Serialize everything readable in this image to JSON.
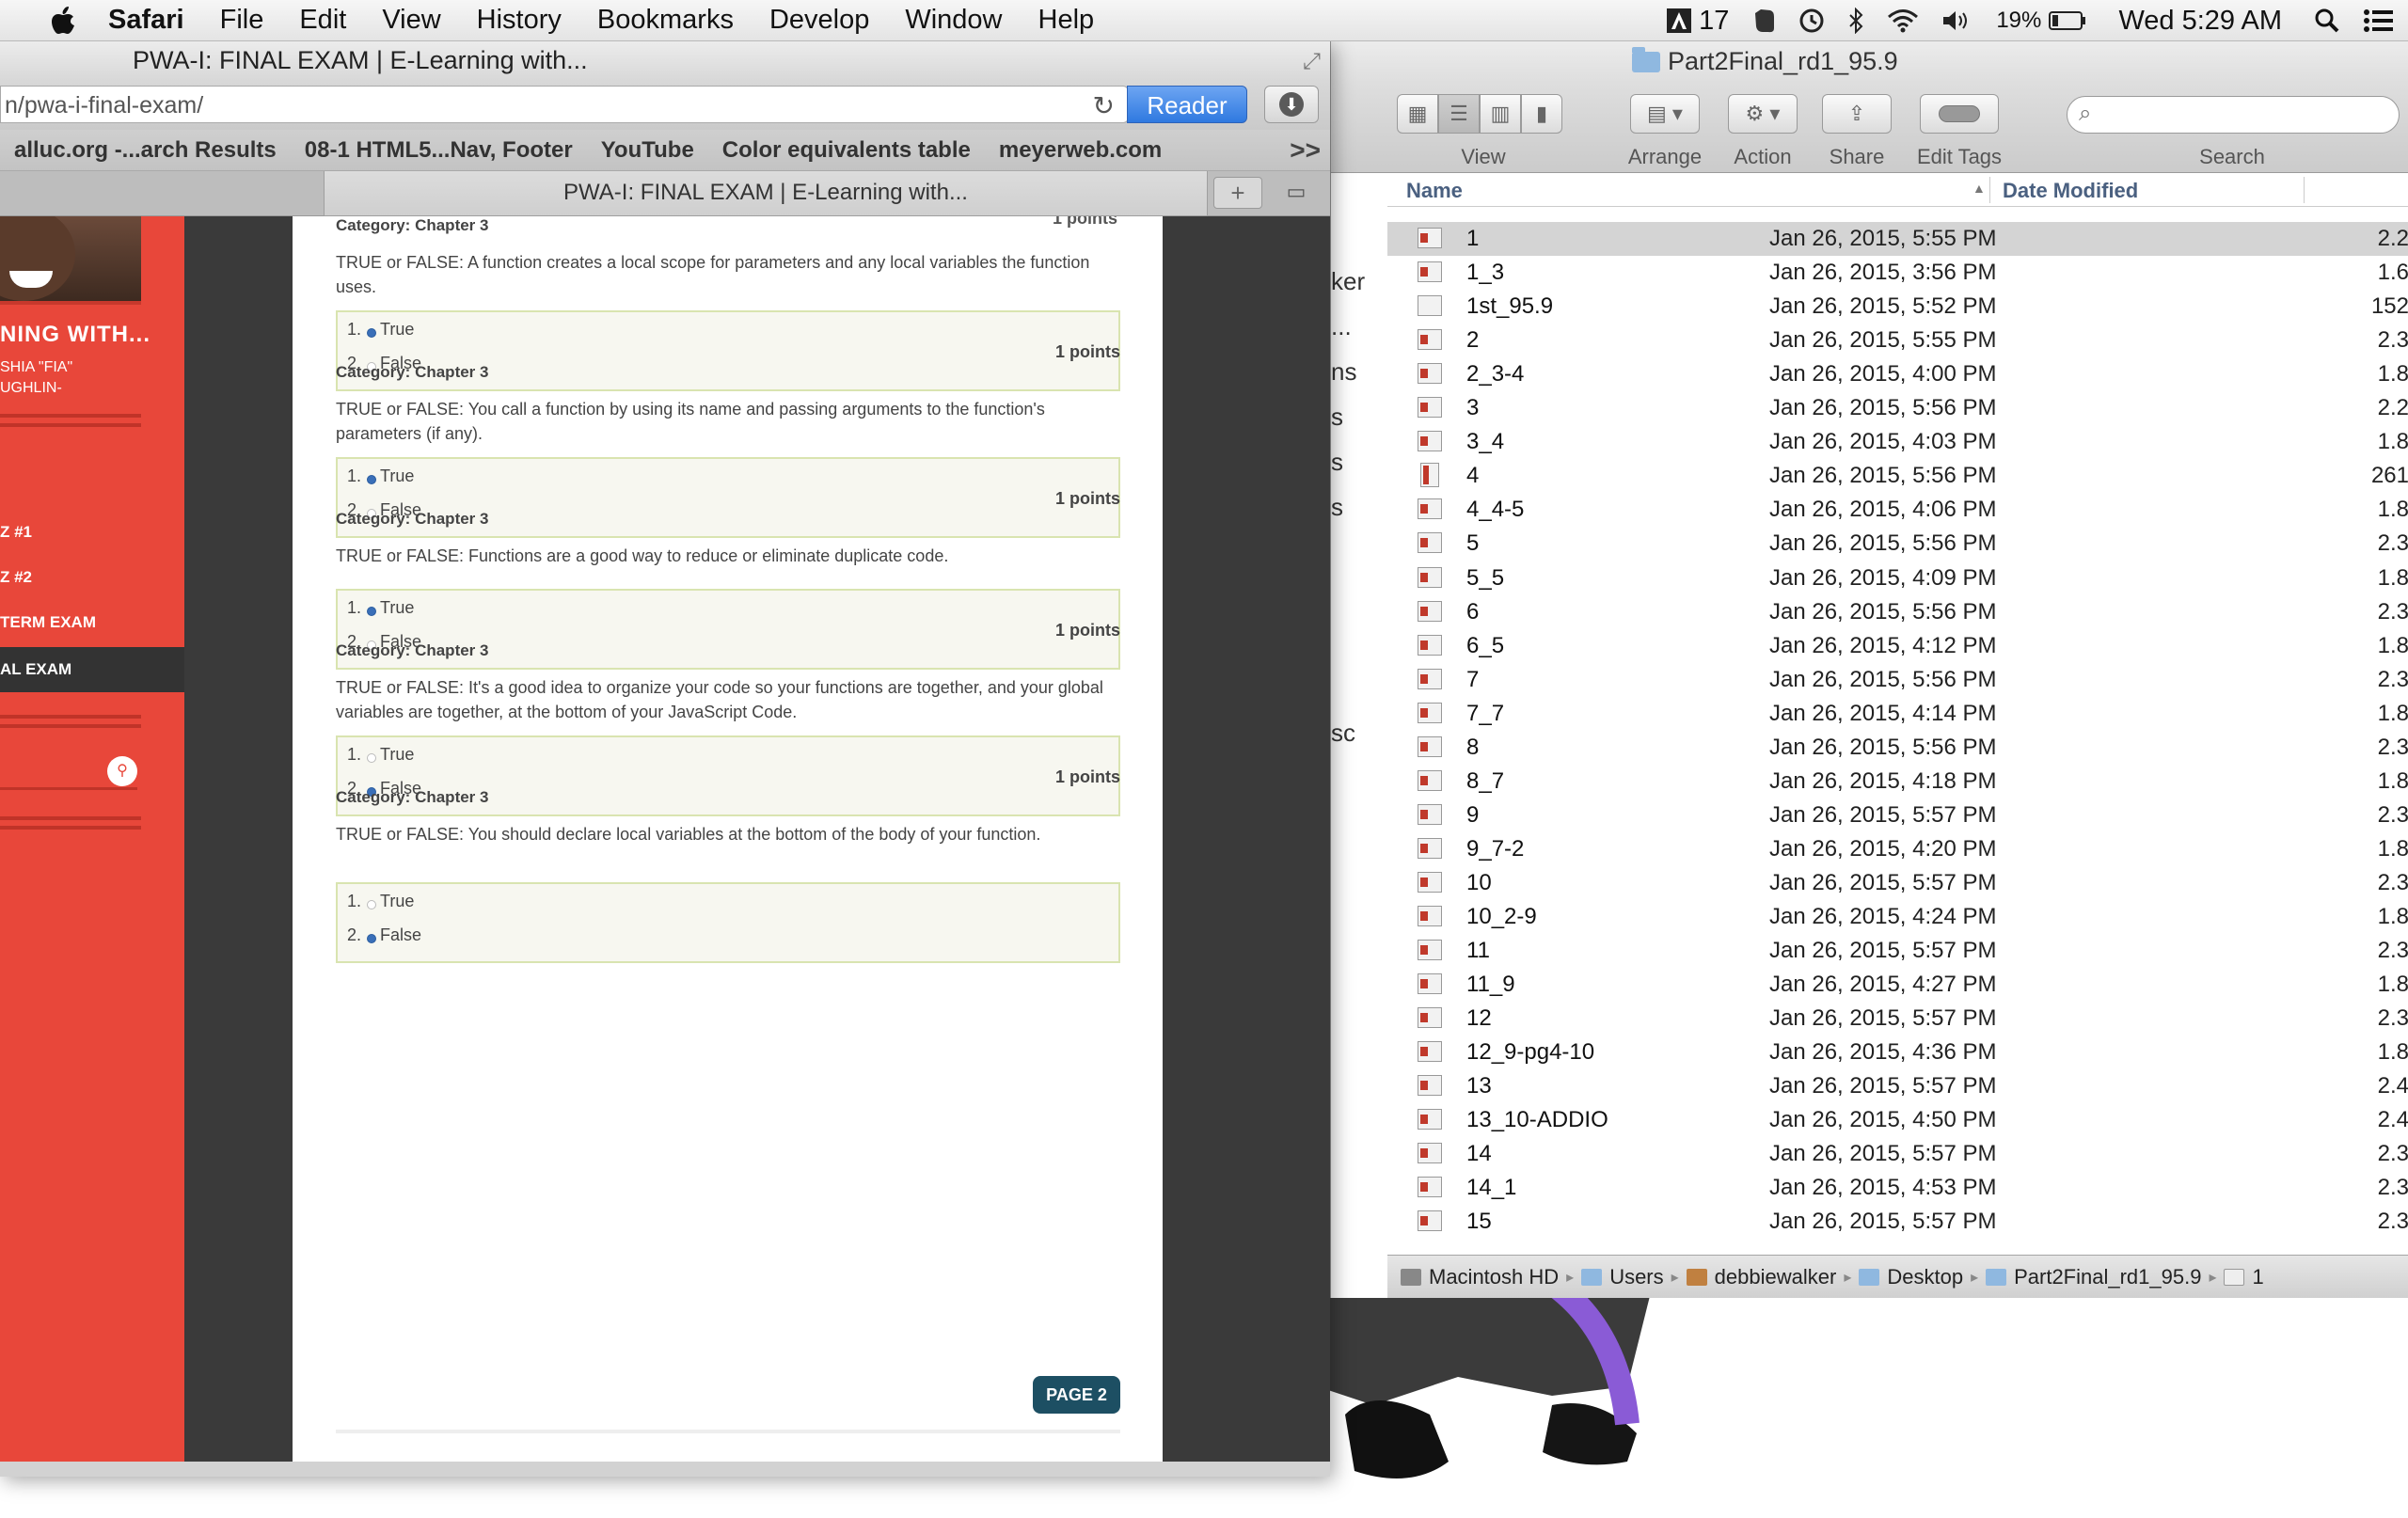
{
  "menubar": {
    "app": "Safari",
    "items": [
      "File",
      "Edit",
      "View",
      "History",
      "Bookmarks",
      "Develop",
      "Window",
      "Help"
    ],
    "status": {
      "adobe_count": "17",
      "battery": "19%",
      "clock": "Wed 5:29 AM"
    }
  },
  "safari": {
    "title": "PWA-I: FINAL EXAM | E-Learning with...",
    "url": "n/pwa-i-final-exam/",
    "reader_label": "Reader",
    "bookmarks": [
      "alluc.org -...arch Results",
      "08-1 HTML5...Nav, Footer",
      "YouTube",
      "Color equivalents table",
      "meyerweb.com"
    ],
    "more": ">>",
    "tab_title": "PWA-I: FINAL EXAM | E-Learning with...",
    "tab_add": "+"
  },
  "sidebar": {
    "site_title": "NING WITH...",
    "author": "SHIA \"FIA\"\nUGHLIN-",
    "nav": [
      "Z #1",
      "Z #2",
      "TERM EXAM",
      "AL EXAM"
    ],
    "active_index": 3
  },
  "quiz": {
    "top_points": "1 points",
    "questions": [
      {
        "points": "",
        "category": "Category: Chapter 3",
        "text": "TRUE or FALSE:  A function creates a local scope for parameters and any local variables the function uses.",
        "options": [
          {
            "num": "1.",
            "label": "True",
            "selected": true
          },
          {
            "num": "2.",
            "label": "False",
            "selected": false
          }
        ]
      },
      {
        "points": "1 points",
        "category": "Category: Chapter 3",
        "text": "TRUE or FALSE:  You call a function by using its name and passing arguments to the function's parameters (if any).",
        "options": [
          {
            "num": "1.",
            "label": "True",
            "selected": true
          },
          {
            "num": "2.",
            "label": "False",
            "selected": false
          }
        ]
      },
      {
        "points": "1 points",
        "category": "Category: Chapter 3",
        "text": "TRUE or FALSE:  Functions are a good way to reduce or eliminate duplicate code.",
        "options": [
          {
            "num": "1.",
            "label": "True",
            "selected": true
          },
          {
            "num": "2.",
            "label": "False",
            "selected": false
          }
        ]
      },
      {
        "points": "1 points",
        "category": "Category: Chapter 3",
        "text": "TRUE or FALSE:  It's a good idea to organize your code so your functions are together, and your global variables are together, at the bottom of your JavaScript Code.",
        "options": [
          {
            "num": "1.",
            "label": "True",
            "selected": false
          },
          {
            "num": "2.",
            "label": "False",
            "selected": true
          }
        ]
      },
      {
        "points": "1 points",
        "category": "Category: Chapter 3",
        "text": "TRUE or FALSE: You should declare local variables at the bottom of the body of your function.",
        "options": [
          {
            "num": "1.",
            "label": "True",
            "selected": false
          },
          {
            "num": "2.",
            "label": "False",
            "selected": true
          }
        ]
      }
    ],
    "page_button": "PAGE 2"
  },
  "finder": {
    "title": "Part2Final_rd1_95.9",
    "toolbar": {
      "view": "View",
      "arrange": "Arrange",
      "action": "Action",
      "share": "Share",
      "edit_tags": "Edit Tags",
      "search": "Search"
    },
    "columns": {
      "name": "Name",
      "date": "Date Modified"
    },
    "left_fragments": [
      "ker",
      "...",
      "ns",
      "s",
      "s",
      "s",
      "sc"
    ],
    "rows": [
      {
        "name": "1",
        "date": "Jan 26, 2015, 5:55 PM",
        "size": "2.2",
        "icon": "pdf",
        "selected": true
      },
      {
        "name": "1_3",
        "date": "Jan 26, 2015, 3:56 PM",
        "size": "1.6",
        "icon": "pdf"
      },
      {
        "name": "1st_95.9",
        "date": "Jan 26, 2015, 5:52 PM",
        "size": "152",
        "icon": "doc"
      },
      {
        "name": "2",
        "date": "Jan 26, 2015, 5:55 PM",
        "size": "2.3",
        "icon": "pdf"
      },
      {
        "name": "2_3-4",
        "date": "Jan 26, 2015, 4:00 PM",
        "size": "1.8",
        "icon": "pdf"
      },
      {
        "name": "3",
        "date": "Jan 26, 2015, 5:56 PM",
        "size": "2.2",
        "icon": "pdf"
      },
      {
        "name": "3_4",
        "date": "Jan 26, 2015, 4:03 PM",
        "size": "1.8",
        "icon": "pdf"
      },
      {
        "name": "4",
        "date": "Jan 26, 2015, 5:56 PM",
        "size": "261",
        "icon": "tall"
      },
      {
        "name": "4_4-5",
        "date": "Jan 26, 2015, 4:06 PM",
        "size": "1.8",
        "icon": "pdf"
      },
      {
        "name": "5",
        "date": "Jan 26, 2015, 5:56 PM",
        "size": "2.3",
        "icon": "pdf"
      },
      {
        "name": "5_5",
        "date": "Jan 26, 2015, 4:09 PM",
        "size": "1.8",
        "icon": "pdf"
      },
      {
        "name": "6",
        "date": "Jan 26, 2015, 5:56 PM",
        "size": "2.3",
        "icon": "pdf"
      },
      {
        "name": "6_5",
        "date": "Jan 26, 2015, 4:12 PM",
        "size": "1.8",
        "icon": "pdf"
      },
      {
        "name": "7",
        "date": "Jan 26, 2015, 5:56 PM",
        "size": "2.3",
        "icon": "pdf"
      },
      {
        "name": "7_7",
        "date": "Jan 26, 2015, 4:14 PM",
        "size": "1.8",
        "icon": "pdf"
      },
      {
        "name": "8",
        "date": "Jan 26, 2015, 5:56 PM",
        "size": "2.3",
        "icon": "pdf"
      },
      {
        "name": "8_7",
        "date": "Jan 26, 2015, 4:18 PM",
        "size": "1.8",
        "icon": "pdf"
      },
      {
        "name": "9",
        "date": "Jan 26, 2015, 5:57 PM",
        "size": "2.3",
        "icon": "pdf"
      },
      {
        "name": "9_7-2",
        "date": "Jan 26, 2015, 4:20 PM",
        "size": "1.8",
        "icon": "pdf"
      },
      {
        "name": "10",
        "date": "Jan 26, 2015, 5:57 PM",
        "size": "2.3",
        "icon": "pdf"
      },
      {
        "name": "10_2-9",
        "date": "Jan 26, 2015, 4:24 PM",
        "size": "1.8",
        "icon": "pdf"
      },
      {
        "name": "11",
        "date": "Jan 26, 2015, 5:57 PM",
        "size": "2.3",
        "icon": "pdf"
      },
      {
        "name": "11_9",
        "date": "Jan 26, 2015, 4:27 PM",
        "size": "1.8",
        "icon": "pdf"
      },
      {
        "name": "12",
        "date": "Jan 26, 2015, 5:57 PM",
        "size": "2.3",
        "icon": "pdf"
      },
      {
        "name": "12_9-pg4-10",
        "date": "Jan 26, 2015, 4:36 PM",
        "size": "1.8",
        "icon": "pdf"
      },
      {
        "name": "13",
        "date": "Jan 26, 2015, 5:57 PM",
        "size": "2.4",
        "icon": "pdf"
      },
      {
        "name": "13_10-ADDIO",
        "date": "Jan 26, 2015, 4:50 PM",
        "size": "2.4",
        "icon": "pdf"
      },
      {
        "name": "14",
        "date": "Jan 26, 2015, 5:57 PM",
        "size": "2.3",
        "icon": "pdf"
      },
      {
        "name": "14_1",
        "date": "Jan 26, 2015, 4:53 PM",
        "size": "2.3",
        "icon": "pdf"
      },
      {
        "name": "15",
        "date": "Jan 26, 2015, 5:57 PM",
        "size": "2.3",
        "icon": "pdf"
      }
    ],
    "path": [
      "Macintosh HD",
      "Users",
      "debbiewalker",
      "Desktop",
      "Part2Final_rd1_95.9",
      "1"
    ]
  }
}
